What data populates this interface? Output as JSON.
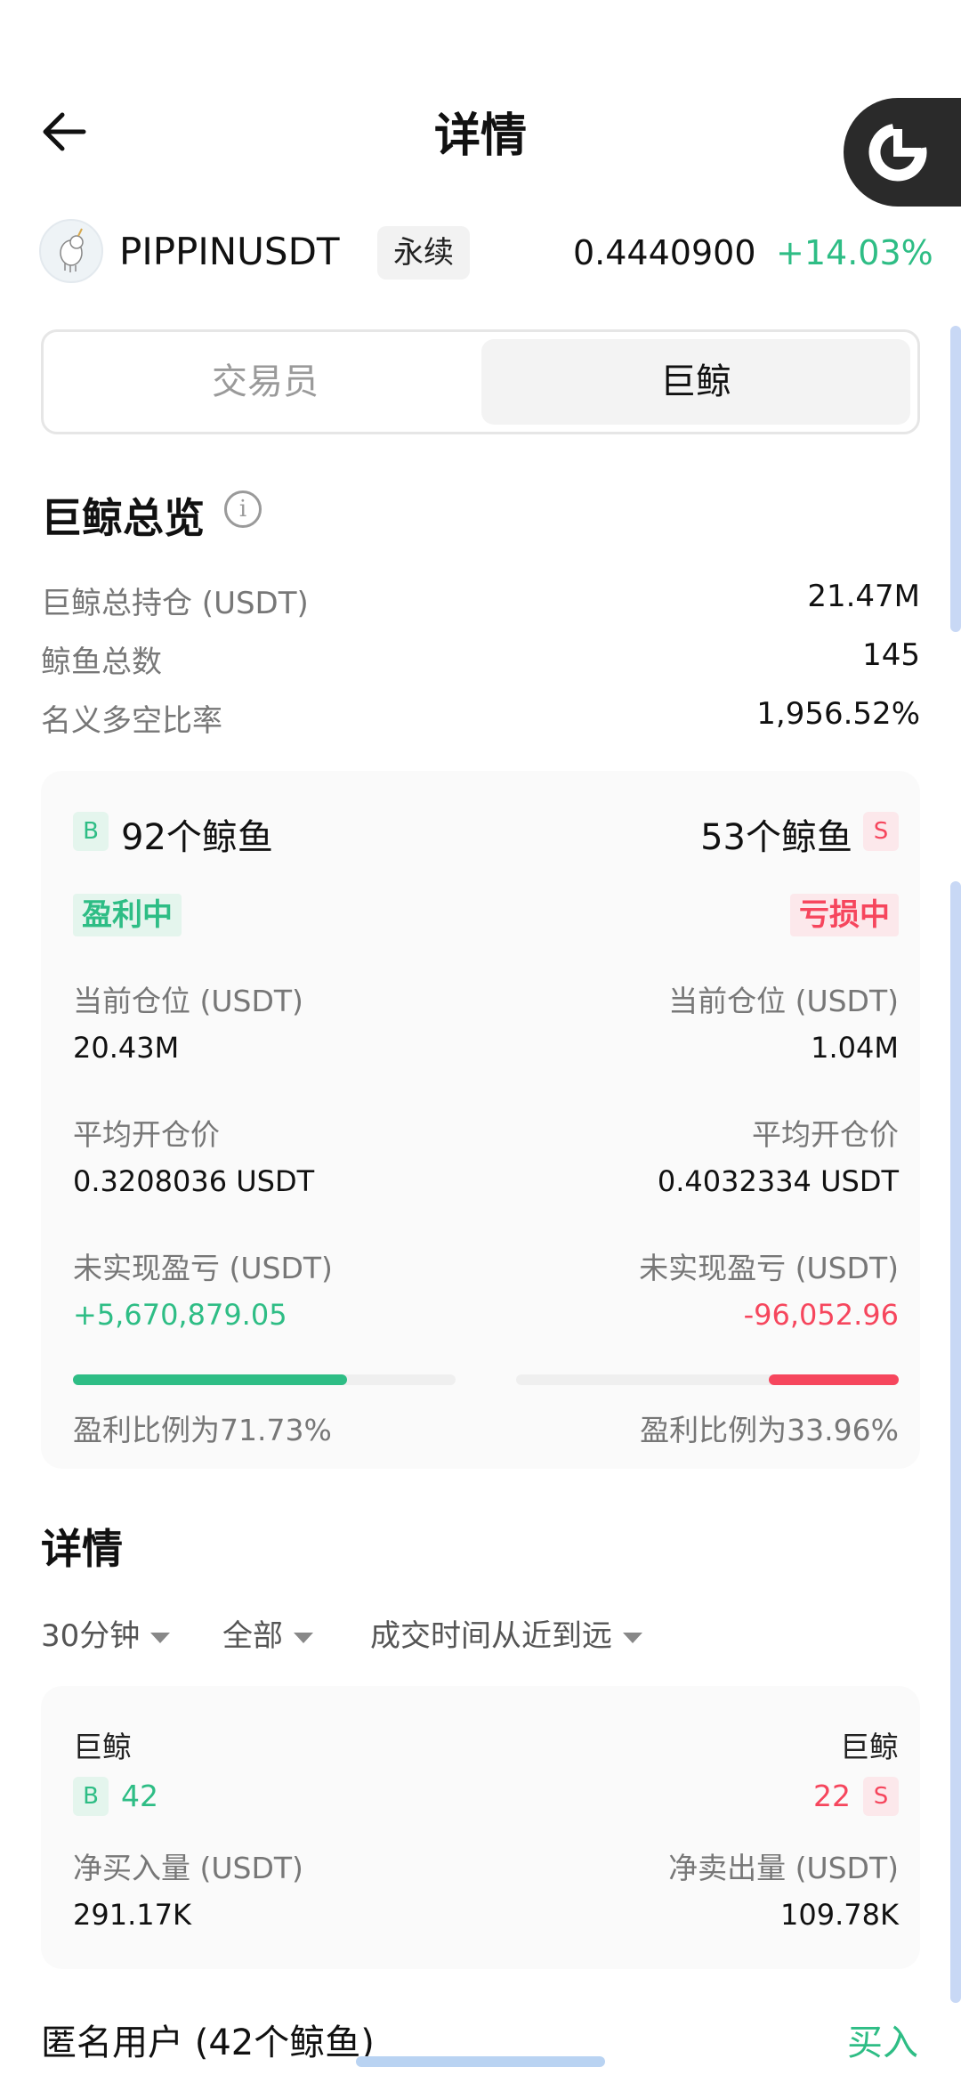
{
  "header": {
    "title": "详情",
    "back_icon": "arrow-left-icon",
    "float_icon": "chart-ring-icon"
  },
  "symbol": {
    "name": "PIPPINUSDT",
    "type_tag": "永续",
    "price": "0.4440900",
    "change": "+14.03%",
    "change_color": "#2ebd85"
  },
  "tabs": [
    {
      "label": "交易员",
      "active": false
    },
    {
      "label": "巨鲸",
      "active": true
    }
  ],
  "overview": {
    "title": "巨鲸总览",
    "rows": [
      {
        "label": "巨鲸总持仓 (USDT)",
        "value": "21.47M"
      },
      {
        "label": "鲸鱼总数",
        "value": "145"
      },
      {
        "label": "名义多空比率",
        "value": "1,956.52%"
      }
    ]
  },
  "whale_card": {
    "long": {
      "badge": "B",
      "count": "92个鲸鱼",
      "status": "盈利中",
      "position_label": "当前仓位 (USDT)",
      "position_value": "20.43M",
      "avg_label": "平均开仓价",
      "avg_value": "0.3208036 USDT",
      "pnl_label": "未实现盈亏 (USDT)",
      "pnl_value": "+5,670,879.05",
      "profit_ratio_text": "盈利比例为71.73%",
      "profit_ratio": 0.7173
    },
    "short": {
      "badge": "S",
      "count": "53个鲸鱼",
      "status": "亏损中",
      "position_label": "当前仓位 (USDT)",
      "position_value": "1.04M",
      "avg_label": "平均开仓价",
      "avg_value": "0.4032334 USDT",
      "pnl_label": "未实现盈亏 (USDT)",
      "pnl_value": "-96,052.96",
      "profit_ratio_text": "盈利比例为33.96%",
      "profit_ratio": 0.3396
    },
    "colors": {
      "profit": "#2ebd85",
      "loss": "#f6465d"
    }
  },
  "details": {
    "title": "详情",
    "filters": [
      {
        "label": "30分钟"
      },
      {
        "label": "全部"
      },
      {
        "label": "成交时间从近到远"
      }
    ],
    "card": {
      "buy_side": {
        "label": "巨鲸",
        "badge": "B",
        "count": "42",
        "net_label": "净买入量 (USDT)",
        "net_value": "291.17K"
      },
      "sell_side": {
        "label": "巨鲸",
        "badge": "S",
        "count": "22",
        "net_label": "净卖出量 (USDT)",
        "net_value": "109.78K"
      }
    },
    "entry": {
      "user": "匿名用户 (42个鲸鱼)",
      "action": "买入"
    }
  }
}
